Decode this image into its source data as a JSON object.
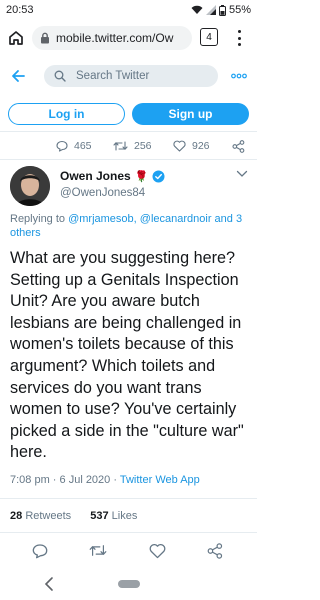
{
  "status_bar": {
    "time": "20:53",
    "battery": "55%"
  },
  "browser": {
    "url": "mobile.twitter.com/Ow",
    "tab_count": "4"
  },
  "twitter_header": {
    "search_placeholder": "Search Twitter"
  },
  "auth": {
    "login_label": "Log in",
    "signup_label": "Sign up"
  },
  "prev_tweet_actions": {
    "replies": "465",
    "retweets": "256",
    "likes": "926"
  },
  "author": {
    "name": "Owen Jones",
    "rose": "🌹",
    "handle": "@OwenJones84"
  },
  "replying": {
    "prefix": "Replying to ",
    "mentions": "@mrjamesob, @lecanardnoir and 3 others"
  },
  "tweet": {
    "text": "What are you suggesting here? Setting up a Genitals Inspection Unit? Are you aware butch lesbians are being challenged in women's toilets because of this argument? Which toilets and services do you want trans women to use? You've certainly picked a side in the \"culture war\" here."
  },
  "meta": {
    "timestamp": "7:08 pm · 6 Jul 2020 · ",
    "source": "Twitter Web App"
  },
  "stats": {
    "retweets_count": "28",
    "retweets_label": "Retweets",
    "likes_count": "537",
    "likes_label": "Likes"
  },
  "colors": {
    "twitter_blue": "#1da1f2",
    "link_blue": "#1b95e0",
    "muted_gray": "#657786",
    "divider": "#e6ecf0"
  },
  "icons": [
    "home-icon",
    "lock-icon",
    "tabs-icon",
    "menu-icon",
    "back-arrow-icon",
    "search-icon",
    "more-icon",
    "reply-icon",
    "retweet-icon",
    "like-icon",
    "share-icon",
    "verified-icon",
    "chevron-down-icon"
  ]
}
